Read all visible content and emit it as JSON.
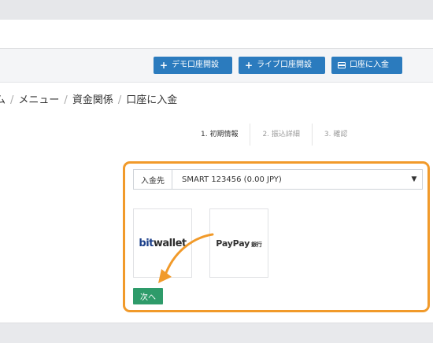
{
  "header": {
    "buttons": [
      {
        "label": "デモ口座開設",
        "icon": "plus-icon"
      },
      {
        "label": "ライブ口座開設",
        "icon": "plus-icon"
      },
      {
        "label": "口座に入金",
        "icon": "card-icon"
      }
    ]
  },
  "breadcrumb": {
    "partial_first": "ム",
    "items": [
      "メニュー",
      "資金関係",
      "口座に入金"
    ],
    "separator": "/"
  },
  "steps": [
    "1. 初期情報",
    "2. 振込詳細",
    "3. 確認"
  ],
  "deposit": {
    "label": "入金先",
    "selected": "SMART 123456 (0.00 JPY)",
    "methods": [
      {
        "name": "bitwallet",
        "logo_a": "bit",
        "logo_b": "wallet"
      },
      {
        "name": "PayPay",
        "logo_a": "PayPay",
        "logo_b": "銀行"
      }
    ],
    "next_label": "次へ"
  },
  "colors": {
    "accent_blue": "#2b7bbe",
    "next_green": "#2e9b6a",
    "highlight_orange": "#f19a2a"
  }
}
